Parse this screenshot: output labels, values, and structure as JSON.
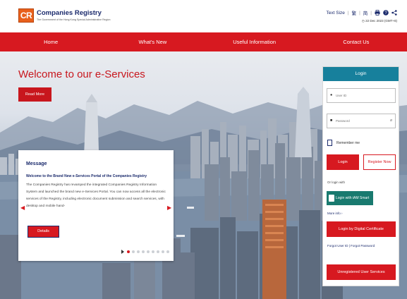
{
  "header": {
    "logo_mark": "CR",
    "title": "Companies Registry",
    "subtitle": "The Government of the Hong Kong Special Administrative Region",
    "text_size_label": "Text Size",
    "lang_traditional": "繁",
    "lang_simplified": "简",
    "date": "22 Dec 2023 (GMT+8)",
    "icons": [
      "print-icon",
      "help-icon",
      "share-icon",
      "clock-icon"
    ]
  },
  "nav": {
    "items": [
      "Home",
      "What's New",
      "Useful Information",
      "Contact Us"
    ]
  },
  "hero": {
    "welcome": "Welcome to our e-Services",
    "read_more": "Read More"
  },
  "message": {
    "title": "Message",
    "headline": "Welcome to the Brand New e-Services Portal of the Companies Registry",
    "body": "The Companies Registry has revamped the integrated Companies Registry Information System and launched the brand new e-Services Portal. You can now access all the electronic services of the Registry, including electronic document submission and search services, with desktop and mobile hand-",
    "details": "Details",
    "carousel_dots": 9,
    "active_dot": 1
  },
  "login": {
    "title": "Login",
    "user_id_placeholder": "User ID",
    "password_placeholder": "Password",
    "remember_me": "Remember me",
    "login_button": "Login",
    "register_button": "Register Now",
    "or_login_with": "Or login with",
    "iam_smart": "Login with iAM Smart",
    "more_info": "More info ›",
    "digital_cert": "Login by Digital Certificate",
    "forgot": "Forgot User ID | Forgot Password",
    "unregistered": "Unregistered User Services"
  },
  "colors": {
    "brand_red": "#d71920",
    "login_header": "#17809c",
    "iam_green": "#197a6f",
    "navy": "#1a2a6c",
    "logo_orange": "#e8601c"
  }
}
